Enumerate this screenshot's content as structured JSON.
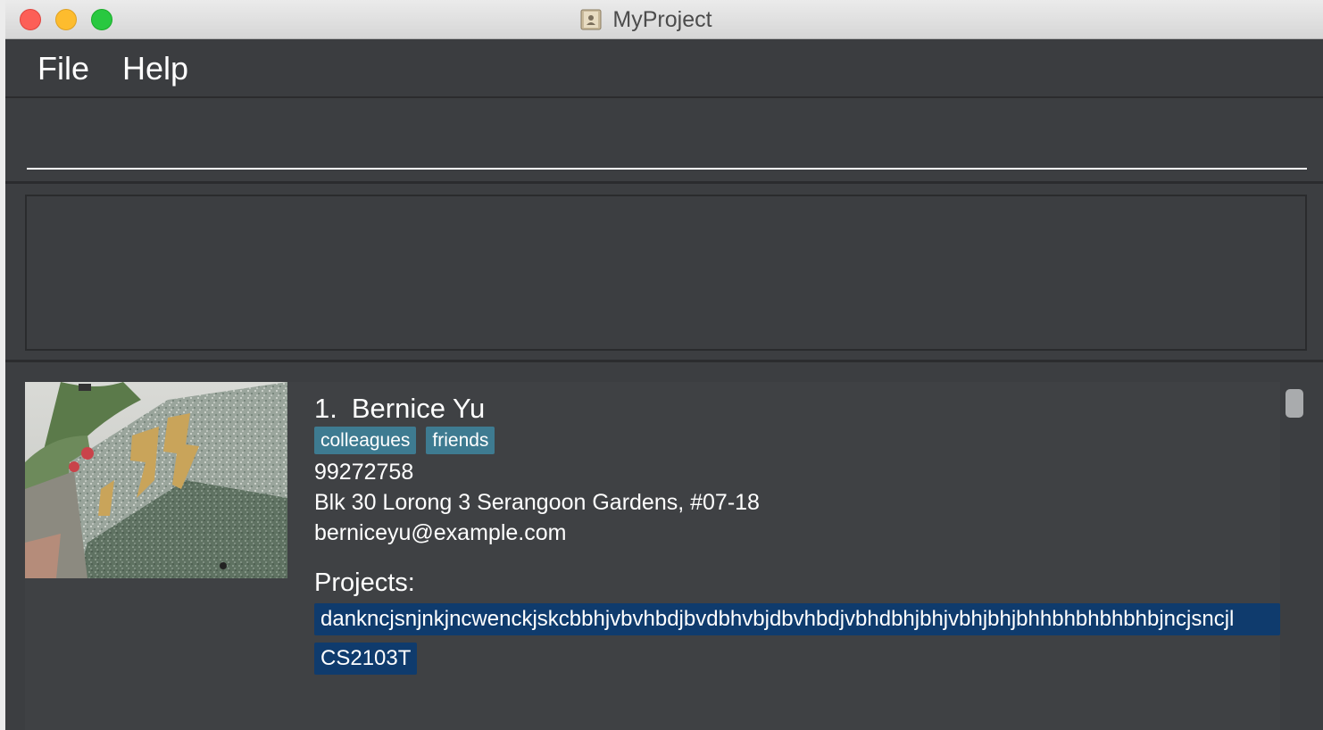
{
  "window": {
    "title": "MyProject"
  },
  "menu": {
    "items": [
      {
        "label": "File"
      },
      {
        "label": "Help"
      }
    ]
  },
  "command_box": {
    "value": "",
    "placeholder": ""
  },
  "result_display": {
    "text": ""
  },
  "persons": [
    {
      "index": "1.",
      "name": "Bernice Yu",
      "tags": [
        "colleagues",
        "friends"
      ],
      "phone": "99272758",
      "address": "Blk 30 Lorong 3 Serangoon Gardens, #07-18",
      "email": "berniceyu@example.com",
      "projects_label": "Projects:",
      "projects": [
        "dankncjsnjnkjncwenckjskcbbhjvbvhbdjbvdbhvbjdbvhbdjvbhdbhjbhjvbhjbhjbhhbhbhbhbhbjncjsncjl",
        "CS2103T"
      ]
    }
  ],
  "colors": {
    "window_bg": "#3c3e41",
    "tag_bg": "#3e7b91",
    "project_bg": "#0f3b6d",
    "close": "#fc5f57",
    "minimize": "#fdbc2e",
    "maximize": "#29c840"
  },
  "icons": {
    "app_icon": "contacts-book-icon"
  }
}
